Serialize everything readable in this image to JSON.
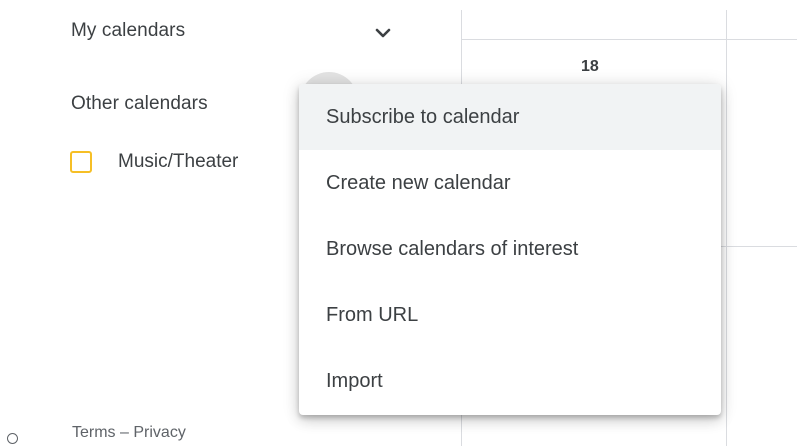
{
  "sidebar": {
    "my_calendars_title": "My calendars",
    "other_calendars_title": "Other calendars",
    "other_calendars": [
      {
        "label": "Music/Theater",
        "color": "#f6bf26"
      }
    ],
    "footer": {
      "terms": "Terms",
      "separator": " – ",
      "privacy": "Privacy"
    }
  },
  "calendar": {
    "day_number": "18"
  },
  "menu": {
    "items": [
      {
        "label": "Subscribe to calendar",
        "active": true
      },
      {
        "label": "Create new calendar",
        "active": false
      },
      {
        "label": "Browse calendars of interest",
        "active": false
      },
      {
        "label": "From URL",
        "active": false
      },
      {
        "label": "Import",
        "active": false
      }
    ]
  },
  "icons": {
    "chevron": "chevron-down-icon",
    "add": "add-circle-icon"
  },
  "colors": {
    "highlight": "#f1f3f4",
    "checkbox": "#f6bf26",
    "grid": "#dadce0"
  }
}
